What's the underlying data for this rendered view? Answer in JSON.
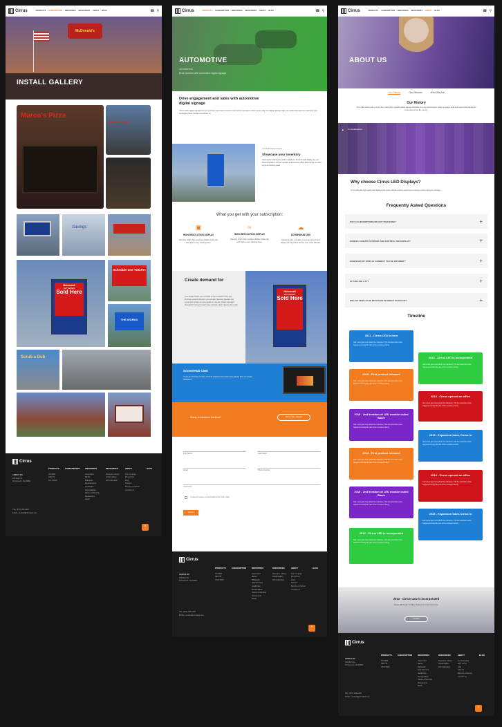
{
  "nav": {
    "brand": "Cirrus",
    "items": [
      "PRODUCTS",
      "SUBSCRIPTION",
      "INDUSTRIES",
      "RESOURCES",
      "ABOUT",
      "BLOG"
    ],
    "p1_active": "SUBSCRIPTION",
    "p2_active": "PRODUCTS",
    "p3_active": "ABOUT"
  },
  "gallery": {
    "hero_title": "INSTALL GALLERY",
    "signs": {
      "marcos": "Marco's Pizza",
      "marcos_small": "Marco's Pizza",
      "savings": "Savings",
      "motorcraft": "Motorcraft",
      "batteries": "BATTERIES",
      "sold_here": "Sold Here",
      "schedule": "Schedule one TODAY!",
      "works": "THE WORKS",
      "scrub": "Scrub a Dub"
    }
  },
  "automotive": {
    "hero_title": "AUTOMOTIVE",
    "hero_sub": "AUTOMOTIVE",
    "hero_line": "Drive revenue with automotive digital signage",
    "intro_title": "Drive engagement and sales with automotive digital signage",
    "intro_text": "Cirrus LED's digital signage lets you promote your brand, inventory and service specials to drivers every day. Our digital displays help your dealership stand out and keep your messaging fresh, flexible and always on.",
    "case_label": "CUSTOM APPLICATION",
    "case_title": "Showcase your inventory",
    "case_text": "Automotive businesses need to stand out. A Cirrus LED display lets you feature vehicles, service specials and financing offers that change as often as your inventory does.",
    "subscription_title": "What you get with your subscription:",
    "features": [
      {
        "icon": "laptop-icon",
        "title": "HIGH-RESOLUTION DISPLAY",
        "text": "Stunning, bright, high-resolution display visible day and night to every passing driver."
      },
      {
        "icon": "wifi-icon",
        "title": "HIGH-RESOLUTION DISPLAY",
        "text": "Stunning, bright, high-resolution display visible day and night to every passing driver."
      },
      {
        "icon": "cloud-icon",
        "title": "SCREENHUB CMS",
        "text": "Upload designs, schedule content and control your display from anywhere with our easy cloud software."
      }
    ],
    "demand_title": "Create demand for",
    "demand_text": "Your display keeps your message in front of drivers every day. Promote seasonal services, new arrivals, financing specials and events with content you can update in minutes. Rotate messages throughout the day to reach more customers and measure the results.",
    "cms_title": "ScreenHub CMS",
    "cms_text": "Create and manage content, schedule playlists and monitor every display from one simple dashboard.",
    "cta_text": "Ready to transform the drive?",
    "cta_button": "Book today / request",
    "form": {
      "first_name": "First Name",
      "last_name": "Last Name",
      "email": "Email",
      "phone": "Phone Number",
      "comments": "Comments",
      "consent": "I consent to receive communications from Cirrus LED.",
      "submit": "Submit"
    }
  },
  "about": {
    "hero_title": "ABOUT US",
    "tabs": [
      "Our History",
      "Our Mission",
      "Who We Are"
    ],
    "history_title": "Our History",
    "history_text": "Cirrus LED started with a simple idea: make bright, beautiful digital signage affordable for every local business. Today we design, build and support LED displays for businesses across the country.",
    "video_label": "Our Headquarters",
    "why_title": "Why choose Cirrus LED Displays?",
    "why_text": "Cirrus LED pairs high quality LED displays with simple software and the support your business needs to share its message.",
    "faq_title": "Frequently Asked Questions",
    "faqs": [
      "WHY A SUBSCRIPTION AND NOT FINANCING?",
      "HOW DO I CREATE CONTENT AND CONTROL THE DISPLAY?",
      "HOW DOES MY DISPLAY CONNECT TO THE INTERNET?",
      "IS THIS LIKE A TV?",
      "WILL MY DISPLAY BE READABLE IN DIRECT SUNLIGHT?"
    ],
    "timeline_title": "Timeline",
    "timeline": [
      {
        "title": "2011 - Cirrus LED is born",
        "color": "#1e7fd4"
      },
      {
        "title": "2012 - Cirrus LED is incorporated",
        "color": "#2ecc40"
      },
      {
        "title": "2013 - First product released",
        "color": "#f47c20"
      },
      {
        "title": "2014 - Cirrus opened an office",
        "color": "#d0141b"
      },
      {
        "title": "2015 - 2nd iteration of LED module called Blade",
        "color": "#7a26c9"
      },
      {
        "title": "2015 - Expansion takes Cirrus to",
        "color": "#1e7fd4"
      },
      {
        "title": "2013 - First product released",
        "color": "#f47c20"
      },
      {
        "title": "2014 - Cirrus opened an office",
        "color": "#d0141b"
      },
      {
        "title": "2015 - 2nd iteration of LED module called Blade",
        "color": "#7a26c9"
      },
      {
        "title": "2015 - Expansion takes Cirrus to",
        "color": "#1e7fd4"
      },
      {
        "title": "2012 - Cirrus LED is incorporated",
        "color": "#2ecc40"
      }
    ],
    "timeline_text": "Some text goes here about the milestone. This line describes what happened during this part of the company history.",
    "banner_title": "2012 - Cirrus LED is incorporated",
    "banner_text": "Cirrus LED began building displays for local businesses.",
    "banner_button": "Contact"
  },
  "footer": {
    "brand": "Cirrus",
    "company": "CIRRUS INC",
    "address1": "200 Main St.",
    "address2": "Portsmouth, NH 03801",
    "phone": "TEL: (877) 456-2220",
    "email": "EMAIL: contact@cirrusled.com",
    "products": {
      "head": "PRODUCTS",
      "items": [
        "OS 9000",
        "NEO 50",
        "OS 9 5000"
      ]
    },
    "subscription": {
      "head": "SUBSCRIPTION",
      "items": []
    },
    "industries": {
      "head": "INDUSTRIES",
      "items": [
        "Automotive",
        "Banks",
        "Billboards",
        "Entertainment",
        "Healthcare",
        "Municipalities",
        "Places of Worship",
        "Restaurants",
        "Retail"
      ]
    },
    "resources": {
      "head": "RESOURCES",
      "items": [
        "Resource Library",
        "Install Gallery",
        "ROI Calculator"
      ]
    },
    "about": {
      "head": "ABOUT",
      "items": [
        "Our Company",
        "Why Cirrus",
        "FAQ",
        "Careers",
        "Become a Partner",
        "Contact Us"
      ]
    },
    "blog": {
      "head": "BLOG",
      "items": []
    },
    "to_top": "^"
  },
  "colors": {
    "accent": "#f47c20",
    "dark": "#1c1c1c",
    "purple": "#5a3a8a",
    "green": "#3a8a3a"
  }
}
